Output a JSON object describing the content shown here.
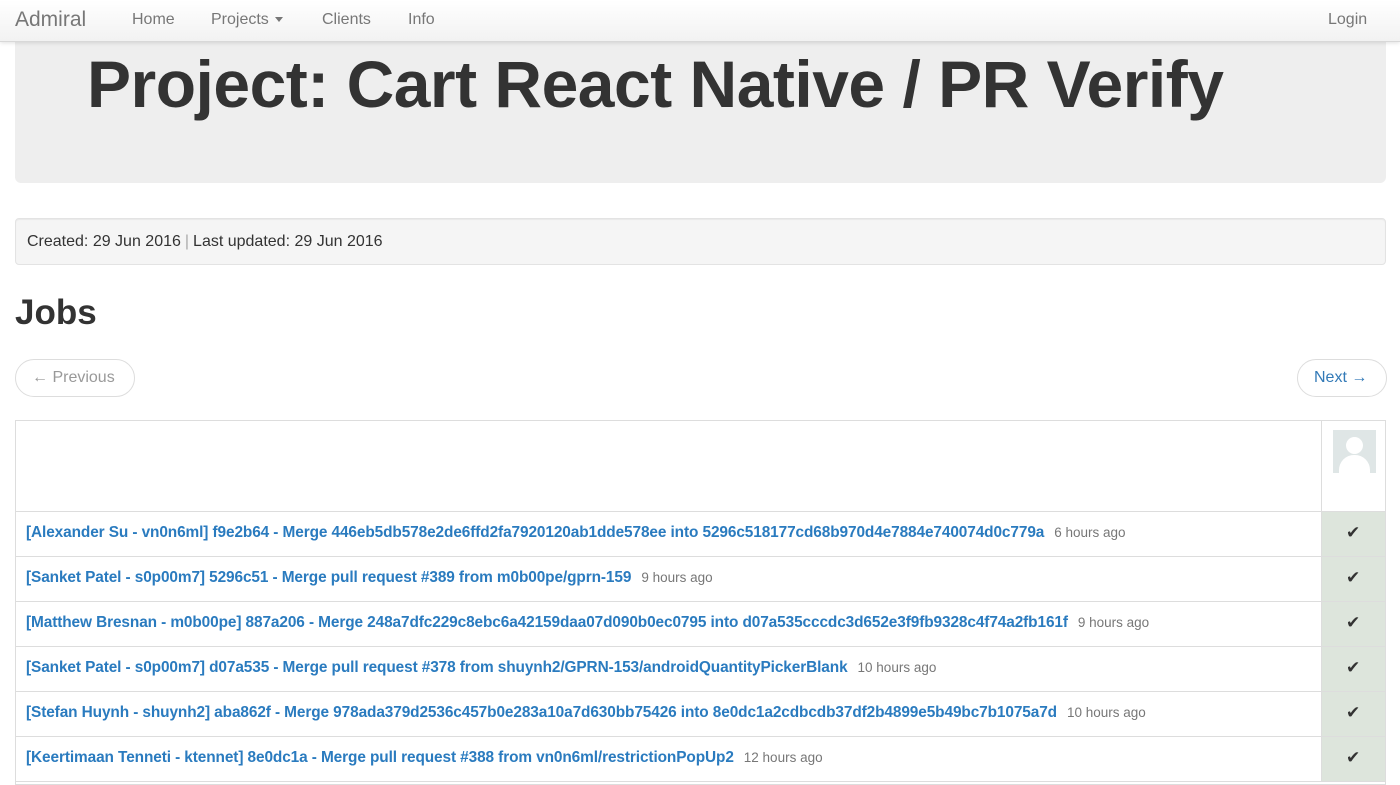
{
  "navbar": {
    "brand": "Admiral",
    "home": "Home",
    "projects": "Projects",
    "clients": "Clients",
    "info": "Info",
    "login": "Login"
  },
  "page": {
    "title": "Project: Cart React Native / PR Verify",
    "created": "Created: 29 Jun 2016",
    "separator": "|",
    "updated": "Last updated: 29 Jun 2016",
    "jobs_heading": "Jobs"
  },
  "pager": {
    "previous": "← Previous",
    "next": "Next →"
  },
  "jobs": [
    {
      "title": "[Alexander Su - vn0n6ml] f9e2b64 - Merge 446eb5db578e2de6ffd2fa7920120ab1dde578ee into 5296c518177cd68b970d4e7884e740074d0c779a",
      "time": "6 hours ago",
      "status": "✔"
    },
    {
      "title": "[Sanket Patel - s0p00m7] 5296c51 - Merge pull request #389 from m0b00pe/gprn-159",
      "time": "9 hours ago",
      "status": "✔"
    },
    {
      "title": "[Matthew Bresnan - m0b00pe] 887a206 - Merge 248a7dfc229c8ebc6a42159daa07d090b0ec0795 into d07a535cccdc3d652e3f9fb9328c4f74a2fb161f",
      "time": "9 hours ago",
      "status": "✔"
    },
    {
      "title": "[Sanket Patel - s0p00m7] d07a535 - Merge pull request #378 from shuynh2/GPRN-153/androidQuantityPickerBlank",
      "time": "10 hours ago",
      "status": "✔"
    },
    {
      "title": "[Stefan Huynh - shuynh2] aba862f - Merge 978ada379d2536c457b0e283a10a7d630bb75426 into 8e0dc1a2cdbcdb37df2b4899e5b49bc7b1075a7d",
      "time": "10 hours ago",
      "status": "✔"
    },
    {
      "title": "[Keertimaan Tenneti - ktennet] 8e0dc1a - Merge pull request #388 from vn0n6ml/restrictionPopUp2",
      "time": "12 hours ago",
      "status": "✔"
    }
  ],
  "icons": {
    "avatar": "user-avatar-icon",
    "status": "check-icon",
    "dropdown": "caret-down-icon"
  },
  "colors": {
    "link": "#2a7bbf",
    "success_cell": "#dde5dc",
    "jumbotron": "#eeeeee"
  }
}
